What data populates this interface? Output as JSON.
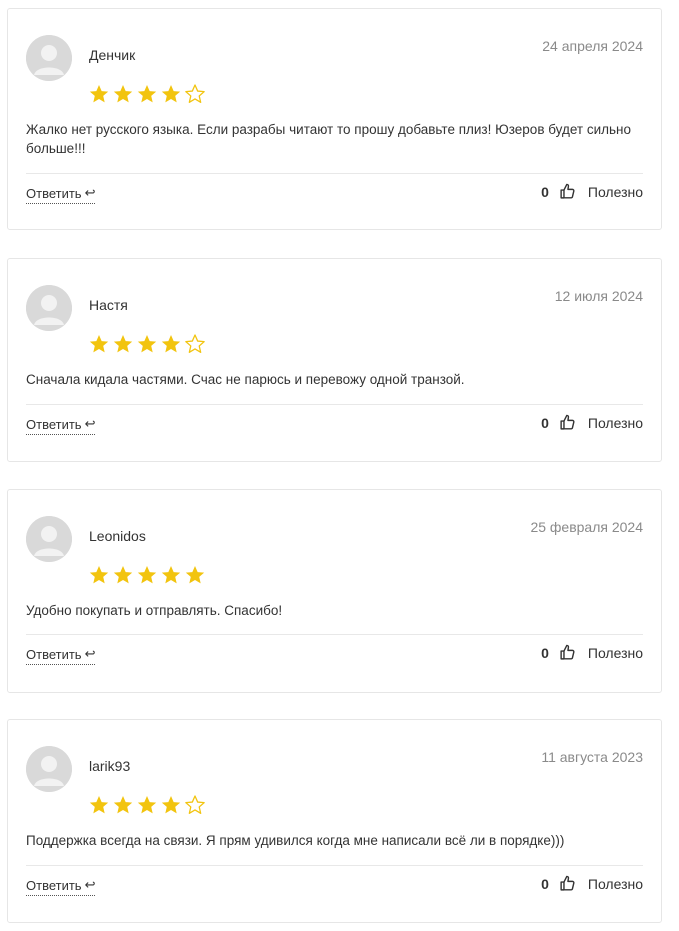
{
  "colors": {
    "star_filled": "#f2c40f",
    "star_empty": "#f2c40f",
    "border": "#e6e6e6",
    "date": "#8a8a8a"
  },
  "icons": {
    "avatar": "user-placeholder-icon",
    "reply": "reply-arrow-icon",
    "like": "thumbs-up-icon",
    "star": "star-icon"
  },
  "reply_label": "Ответить",
  "useful_label": "Полезно",
  "reviews": [
    {
      "author": "Денчик",
      "date": "24 апреля 2024",
      "rating": 4,
      "max_rating": 5,
      "text": "Жалко нет русского языка. Если разрабы читают то прошу добавьте плиз! Юзеров будет сильно больше!!!",
      "likes": "0"
    },
    {
      "author": "Настя",
      "date": "12 июля 2024",
      "rating": 4,
      "max_rating": 5,
      "text": "Сначала кидала частями. Счас не парюсь и перевожу одной транзой.",
      "likes": "0"
    },
    {
      "author": "Leonidos",
      "date": "25 февраля 2024",
      "rating": 5,
      "max_rating": 5,
      "text": "Удобно покупать и отправлять. Спасибо!",
      "likes": "0"
    },
    {
      "author": "larik93",
      "date": "11 августа 2023",
      "rating": 4,
      "max_rating": 5,
      "text": "Поддержка всегда на связи. Я прям удивился когда мне написали всё ли в порядке)))",
      "likes": "0"
    }
  ]
}
